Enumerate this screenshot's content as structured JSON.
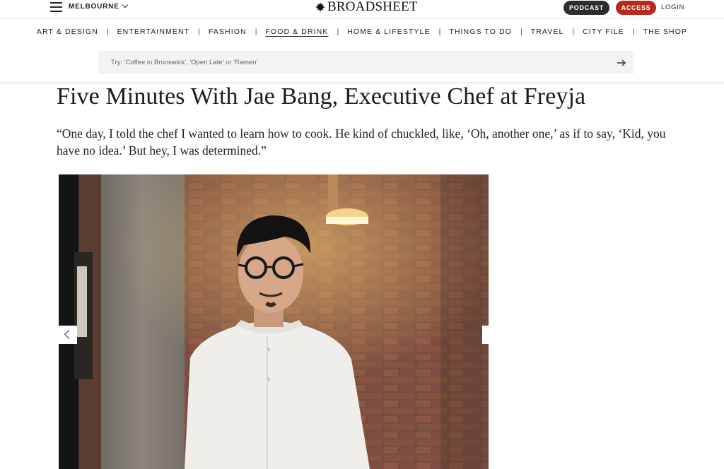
{
  "header": {
    "city": "MELBOURNE",
    "logo_text": "BROADSHEET",
    "podcast_label": "PODCAST",
    "access_label": "ACCESS",
    "login_label": "LOGIN"
  },
  "nav": {
    "items": [
      {
        "label": "ART & DESIGN",
        "active": false
      },
      {
        "label": "ENTERTAINMENT",
        "active": false
      },
      {
        "label": "FASHION",
        "active": false
      },
      {
        "label": "FOOD & DRINK",
        "active": true
      },
      {
        "label": "HOME & LIFESTYLE",
        "active": false
      },
      {
        "label": "THINGS TO DO",
        "active": false
      },
      {
        "label": "TRAVEL",
        "active": false
      },
      {
        "label": "CITY FILE",
        "active": false
      },
      {
        "label": "THE SHOP",
        "active": false
      }
    ],
    "separator": "|"
  },
  "search": {
    "placeholder": "Try: 'Coffee in Brunswick', 'Open Late' or 'Ramen'"
  },
  "article": {
    "title": "Five Minutes With Jae Bang, Executive Chef at Freyja",
    "dek": "“One day, I told the chef I wanted to learn how to cook. He kind of chuckled, like, ‘Oh, another one,’ as if to say, ‘Kid, you have no idea.’ But hey, I was determined.”"
  },
  "icons": {
    "menu": "hamburger-menu-icon",
    "city_dropdown": "chevron-down-icon",
    "logo_mark": "starburst-logo-icon",
    "search_submit": "arrow-right-icon",
    "prev": "chevron-left-icon"
  },
  "colors": {
    "accent_red": "#b52a1c",
    "podcast_dark": "#2c2c2c"
  }
}
